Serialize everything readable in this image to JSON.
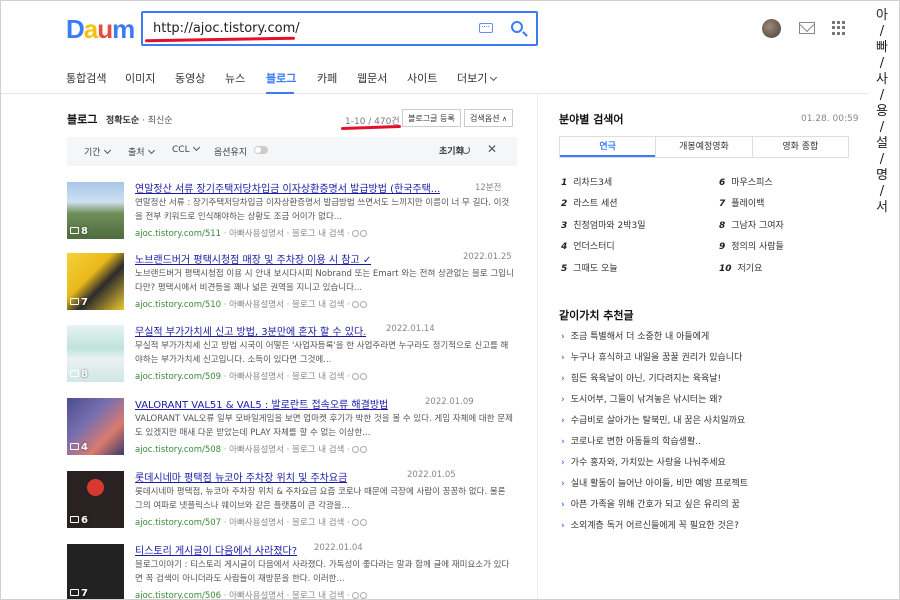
{
  "header": {
    "logo": [
      "D",
      "a",
      "u",
      "m"
    ],
    "logo_colors": [
      "#3b7bf5",
      "#f3c20f",
      "#e64b3b",
      "#3b7bf5"
    ],
    "search_value": "http://ajoc.tistory.com/"
  },
  "side_vertical": [
    "아",
    "/",
    "빠",
    "/",
    "사",
    "/",
    "용",
    "/",
    "설",
    "/",
    "명",
    "/",
    "서"
  ],
  "nav": {
    "items": [
      "통합검색",
      "이미지",
      "동영상",
      "뉴스",
      "블로그",
      "카페",
      "웹문서",
      "사이트",
      "더보기"
    ]
  },
  "blog": {
    "title": "블로그",
    "sort_accuracy": "정확도순",
    "sort_latest": "최신순",
    "count": "1-10 / 470건",
    "register": "블로그글 등록",
    "options": "검색옵션",
    "filters": {
      "period": "기간",
      "source": "출처",
      "ccl": "CCL",
      "keep": "옵션유지",
      "reset": "초기화"
    },
    "results": [
      {
        "title": "연말정산 서류 장기주택저당차입금 이자상환증명서 발급방법 (한국주택...",
        "date": "12분전",
        "desc": "연말정산 서류 : 장기주택저당차입금 이자상환증명서 발급방법 쓰면서도 느끼지만 이름이 너 무 길다. 이것을 전부 키워드로 인식해야하는 상황도 조금 어이가 없다...",
        "url": "ajoc.tistory.com/511",
        "source": "아빠사용설명서",
        "search_label": "블로그 내 검색",
        "img_count": "8"
      },
      {
        "title": "노브랜드버거 평택시청점 매장 및 주차장 이용 시 참고 ✓",
        "date": "2022.01.25",
        "desc": "노브랜드버거 평택시청점 이용 시 안내 보시다시피 Nobrand 또는 Emart 와는 전혀 상관없는 블로 그입니다만? 평택시에서 비견등을 꽤나 넓은 권역을 지니고 있습니다...",
        "url": "ajoc.tistory.com/510",
        "source": "아빠사용설명서",
        "search_label": "블로그 내 검색",
        "img_count": "7"
      },
      {
        "title": "무실적 부가가치세 신고 방법, 3분만에 혼자 할 수 있다.",
        "date": "2022.01.14",
        "desc": "무실적 부가가치세 신고 방법 시국이 어떻든 '사업자등록'을 한 사업주라면 누구라도 정기적으로 신고를 해야하는 부가가치세 신고입니다. 소득이 있다면 그것에...",
        "url": "ajoc.tistory.com/509",
        "source": "아빠사용설명서",
        "search_label": "블로그 내 검색",
        "img_count": "8"
      },
      {
        "title": "VALORANT VAL51 & VAL5 : 발로란트 접속오류 해결방법",
        "date": "2022.01.09",
        "desc": "VALORANT VAL오류 일부 모바일게임을 보면 업마켓 후기가 박한 것을 볼 수 있다. 게임 자체에 대한 문제도 있겠지만 매새 다운 받았는데 PLAY 자체를 할 수 없는 이상한...",
        "url": "ajoc.tistory.com/508",
        "source": "아빠사용설명서",
        "search_label": "블로그 내 검색",
        "img_count": "4"
      },
      {
        "title": "롯데시네마 평택점 뉴코아 주차장 위치 및 주차요금",
        "date": "2022.01.05",
        "desc": "롯데시네마 평택점, 뉴코아 주차장 위치 & 주차요금 요즘 코로나 때문에 극장에 사람이 꽁꽁하 없다. 물론 그의 여파로 넷플릭스나 웨이브와 같은 플랫폼이 큰 각광을...",
        "url": "ajoc.tistory.com/507",
        "source": "아빠사용설명서",
        "search_label": "블로그 내 검색",
        "img_count": "6"
      },
      {
        "title": "티스토리 게시글이 다음에서 사라졌다?",
        "date": "2022.01.04",
        "desc": "블로그이야기 : 티스토리 게시글이 다음에서 사라졌다. 가독성이 좋다라는 말과 함께 글에 재미요소가 있다면 꼭 검색이 아니더라도 사람들이 재방문을 한다. 이러한...",
        "url": "ajoc.tistory.com/506",
        "source": "아빠사용설명서",
        "search_label": "블로그 내 검색",
        "img_count": "7"
      }
    ]
  },
  "trend": {
    "title": "분야별 검색어",
    "time": "01.28. 00:59",
    "tabs": [
      "연극",
      "개봉예정영화",
      "영화 종합"
    ],
    "left": [
      {
        "n": "1",
        "t": "리차드3세"
      },
      {
        "n": "2",
        "t": "라스트 세션"
      },
      {
        "n": "3",
        "t": "친정엄마와 2박3일"
      },
      {
        "n": "4",
        "t": "언더스터디"
      },
      {
        "n": "5",
        "t": "그때도 오늘"
      }
    ],
    "right": [
      {
        "n": "6",
        "t": "마우스피스"
      },
      {
        "n": "7",
        "t": "플레이백"
      },
      {
        "n": "8",
        "t": "그남자 그여자"
      },
      {
        "n": "9",
        "t": "정의의 사람들"
      },
      {
        "n": "10",
        "t": "저기요"
      }
    ]
  },
  "recommend": {
    "title": "같이가치 추천글",
    "items": [
      "조금 특별해서 더 소중한 내 아들에게",
      "누구나 휴식하고 내일을 꿈꿀 권리가 있습니다",
      "힘든 육육날이 아닌, 기다려지는 육육날!",
      "도시어부, 그들이 낚겨놓은 낚시터는 왜?",
      "수급비로 살아가는 탈북민, 내 꿈은 사치일까요",
      "코로나로 변한 아동들의 학습생활..",
      "가수 홍자와, 가치있는 사랑을 나눠주세요",
      "실내 활동이 늘어난 아이들, 비만 예방 프로젝트",
      "아픈 가족을 위해 간호가 되고 싶은 유리의 꿈",
      "소외계층 독거 어르신들에게 꼭 필요한 것은?"
    ]
  }
}
